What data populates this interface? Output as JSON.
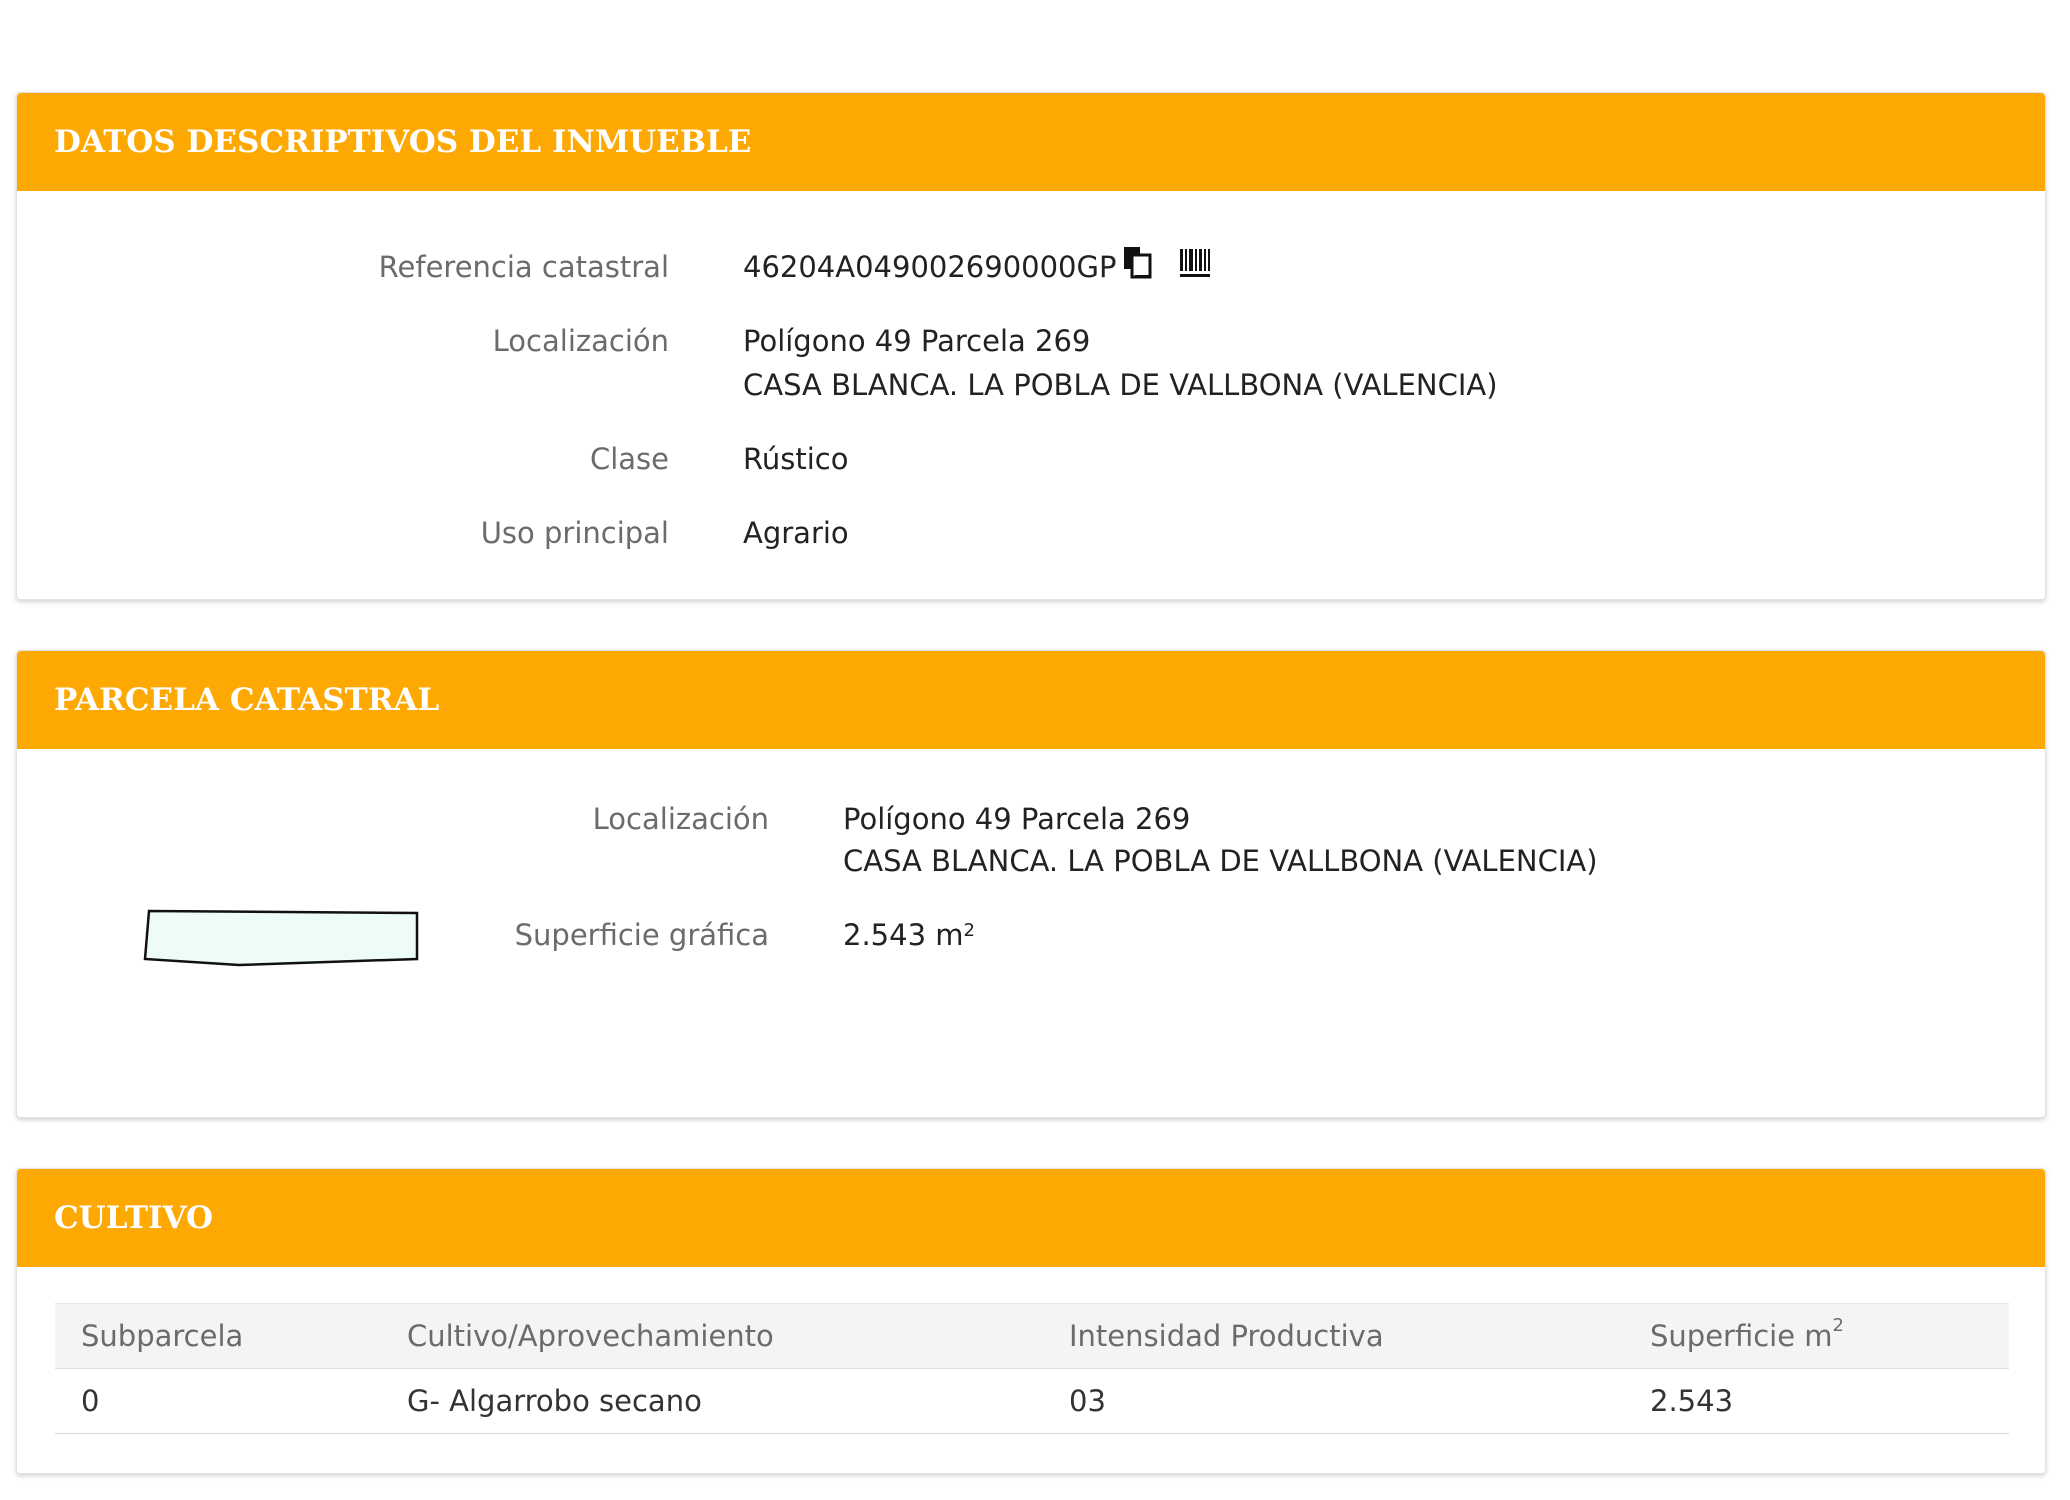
{
  "datos": {
    "title": "DATOS DESCRIPTIVOS DEL INMUEBLE",
    "ref_label": "Referencia catastral",
    "ref_value": "46204A049002690000GP",
    "loc_label": "Localización",
    "loc_line1": "Polígono 49 Parcela 269",
    "loc_line2": "CASA BLANCA. LA POBLA DE VALLBONA (VALENCIA)",
    "clase_label": "Clase",
    "clase_value": "Rústico",
    "uso_label": "Uso principal",
    "uso_value": "Agrario"
  },
  "parcela": {
    "title": "PARCELA CATASTRAL",
    "loc_label": "Localización",
    "loc_line1": "Polígono 49 Parcela 269",
    "loc_line2": "CASA BLANCA. LA POBLA DE VALLBONA (VALENCIA)",
    "sup_label": "Superficie gráfica",
    "sup_value": "2.543 m",
    "sup_unit_exp": "2"
  },
  "cultivo": {
    "title": "CULTIVO",
    "headers": [
      "Subparcela",
      "Cultivo/Aprovechamiento",
      "Intensidad Productiva",
      "Superficie m"
    ],
    "header_exp": "2",
    "rows": [
      [
        "0",
        "G- Algarrobo secano",
        "03",
        "2.543"
      ]
    ]
  },
  "colors": {
    "header_orange": "#fea803",
    "parcel_fill": "#eefcf8"
  },
  "icons": [
    "copy-icon",
    "barcode-icon"
  ]
}
